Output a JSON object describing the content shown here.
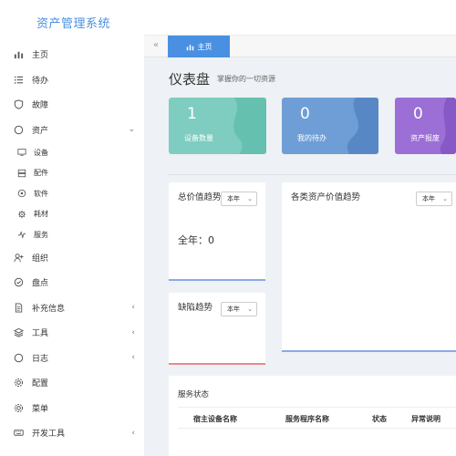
{
  "app": {
    "title": "资产管理系统"
  },
  "sidebar": {
    "items": [
      {
        "key": "home",
        "label": "主页",
        "icon": "bar-chart-icon"
      },
      {
        "key": "todo",
        "label": "待办",
        "icon": "list-icon"
      },
      {
        "key": "fault",
        "label": "故障",
        "icon": "shield-icon"
      },
      {
        "key": "asset",
        "label": "资产",
        "icon": "circle-icon",
        "expanded": true
      },
      {
        "key": "org",
        "label": "组织",
        "icon": "user-plus-icon"
      },
      {
        "key": "inventory",
        "label": "盘点",
        "icon": "check-circle-icon"
      },
      {
        "key": "extra",
        "label": "补充信息",
        "icon": "document-icon",
        "chevron": "‹"
      },
      {
        "key": "tools",
        "label": "工具",
        "icon": "layers-icon",
        "chevron": "‹"
      },
      {
        "key": "log",
        "label": "日志",
        "icon": "circle-icon",
        "chevron": "‹"
      },
      {
        "key": "config",
        "label": "配置",
        "icon": "gear-icon"
      },
      {
        "key": "menu",
        "label": "菜单",
        "icon": "gear-icon"
      },
      {
        "key": "devtools",
        "label": "开发工具",
        "icon": "keyboard-icon",
        "chevron": "‹"
      }
    ],
    "asset_children": [
      {
        "label": "设备",
        "icon": "monitor-icon"
      },
      {
        "label": "配件",
        "icon": "server-icon"
      },
      {
        "label": "软件",
        "icon": "target-icon"
      },
      {
        "label": "耗材",
        "icon": "cog-small-icon"
      },
      {
        "label": "服务",
        "icon": "pulse-icon"
      }
    ],
    "asset_chevron": "⌄"
  },
  "tabs": {
    "toggle": "«",
    "active_label": "主页"
  },
  "dashboard": {
    "title": "仪表盘",
    "subtitle": "掌握你的一切资源"
  },
  "stats": [
    {
      "value": "1",
      "label": "设备数量",
      "color": "#7ecdc0",
      "accent": "#5fbfae"
    },
    {
      "value": "0",
      "label": "我的待办",
      "color": "#6f9ed6",
      "accent": "#4f7fbf"
    },
    {
      "value": "0",
      "label": "资产报废",
      "color": "#9b6fd6",
      "accent": "#8456c4"
    }
  ],
  "cards": {
    "total_value": {
      "title": "总价值趋势",
      "select": "本年",
      "summary": "全年：0"
    },
    "category_value": {
      "title": "各类资产价值趋势",
      "select": "本年"
    },
    "defect": {
      "title": "缺陷趋势",
      "select": "本年"
    }
  },
  "service_status": {
    "title": "服务状态",
    "columns": [
      "宿主设备名称",
      "服务程序名称",
      "状态",
      "异常说明"
    ]
  },
  "colors": {
    "brand": "#4a90e2",
    "blue_line": "#4a90e2",
    "red_line": "#e05a5a"
  }
}
